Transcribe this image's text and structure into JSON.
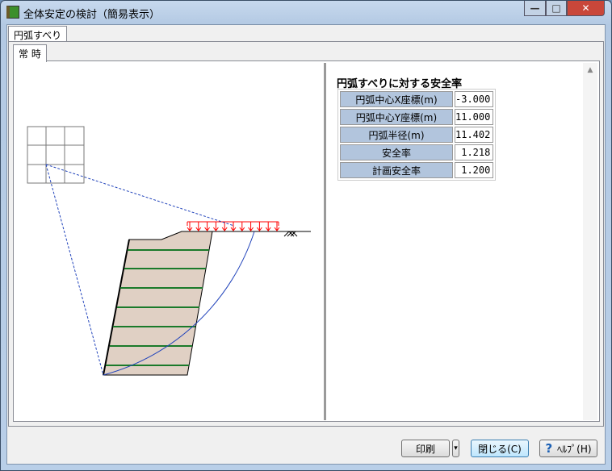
{
  "window": {
    "title": "全体安定の検討（簡易表示）",
    "minimize": "—",
    "maximize": "□",
    "close": "✕"
  },
  "tabs": {
    "outer": "円弧すべり",
    "inner": "常 時"
  },
  "result": {
    "title": "円弧すべりに対する安全率",
    "rows": [
      {
        "label": "円弧中心X座標(m)",
        "value": "-3.000"
      },
      {
        "label": "円弧中心Y座標(m)",
        "value": "11.000"
      },
      {
        "label": "円弧半径(m)",
        "value": "11.402"
      },
      {
        "label": "安全率",
        "value": "1.218"
      },
      {
        "label": "計画安全率",
        "value": "1.200"
      }
    ]
  },
  "buttons": {
    "print": "印刷",
    "dropdown": "▾",
    "close": "閉じる(C)",
    "help": "ﾍﾙﾌﾟ(H)",
    "help_icon": "?"
  },
  "colors": {
    "soil": "#e0d0c4",
    "reinforcement": "#1a7a2a",
    "load": "#ff0000",
    "slip": "#2244bb"
  }
}
